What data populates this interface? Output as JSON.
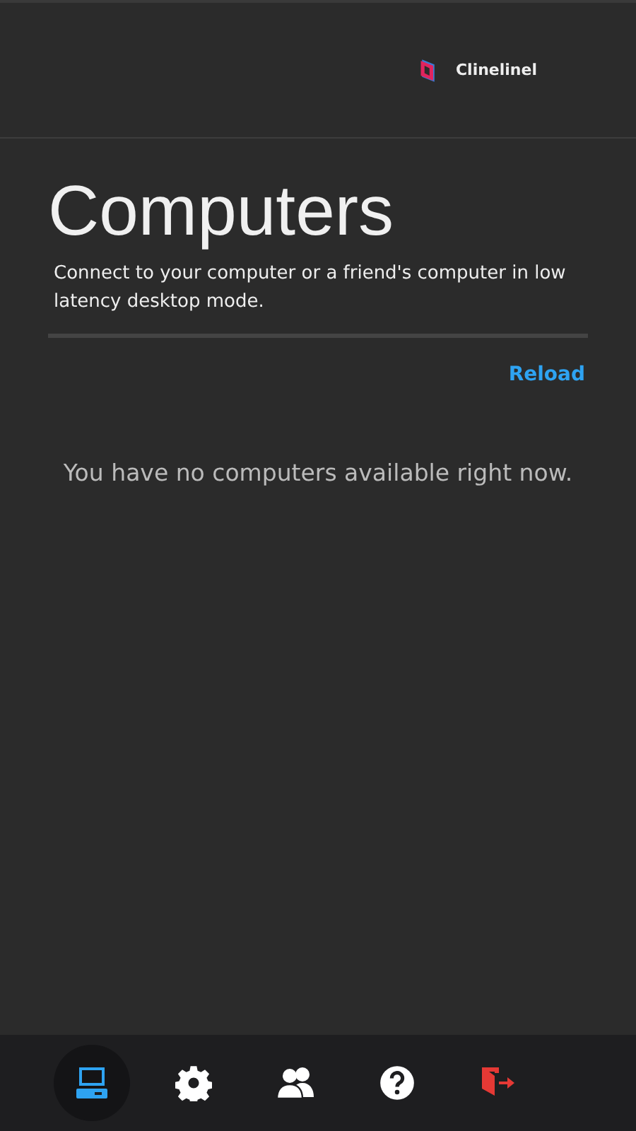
{
  "header": {
    "brand": "Clinelinel"
  },
  "page": {
    "title": "Computers",
    "subtitle": "Connect to your computer or a friend's computer in low latency desktop mode.",
    "reload": "Reload",
    "empty_message": "You have no computers available right now."
  },
  "nav": [
    {
      "kind": "computer",
      "selected": true
    },
    {
      "kind": "settings",
      "selected": false
    },
    {
      "kind": "friends",
      "selected": false
    },
    {
      "kind": "help",
      "selected": false
    },
    {
      "kind": "logout",
      "selected": false
    }
  ]
}
